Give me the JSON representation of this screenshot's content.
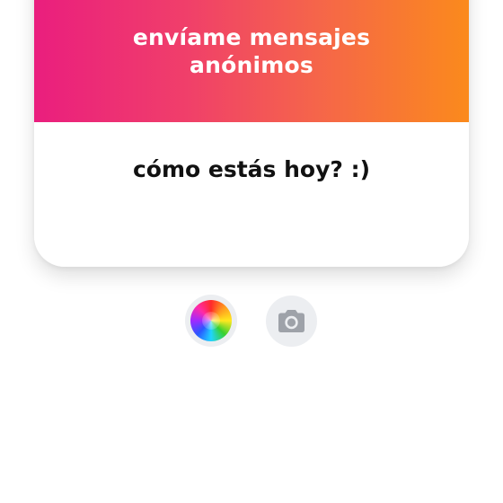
{
  "card": {
    "header_line_1": "envíame mensajes",
    "header_line_2": "anónimos",
    "question": "cómo estás hoy? :)"
  },
  "toolbar": {
    "color_picker_icon": "color-wheel-icon",
    "camera_icon": "camera-icon"
  },
  "colors": {
    "gradient_start": "#ea1e7e",
    "gradient_end": "#fb8a1c",
    "button_background": "#eceef1",
    "camera_icon_color": "#9ea2a9",
    "question_text": "#111111"
  }
}
